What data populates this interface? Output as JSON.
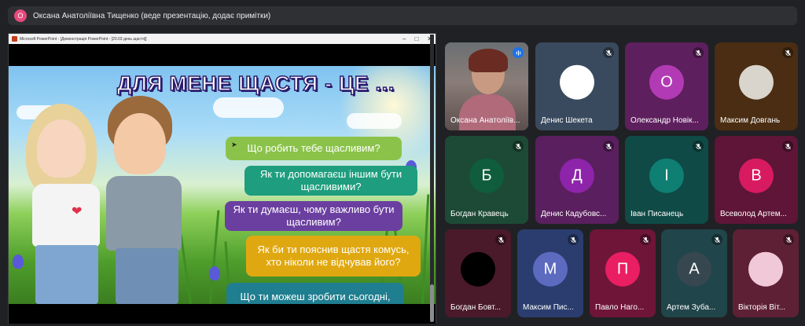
{
  "topbar": {
    "avatar_letter": "О",
    "presenter_text": "Оксана Анатоліївна Тищенко (веде презентацію, додає примітки)"
  },
  "presentation": {
    "window_title": "Microsoft PowerPoint - [Демонстрація PowerPoint - [20.03 день щастя]]",
    "window_controls": [
      "–",
      "□",
      "✕"
    ],
    "slide_title": "ДЛЯ МЕНЕ ЩАСТЯ - ЦЕ ...",
    "questions": [
      "Що робить тебе щасливим?",
      "Як ти допомагаєш іншим бути щасливими?",
      "Як ти думаєш, чому важливо бути щасливим?",
      "Як би ти пояснив щастя комусь, хто ніколи не відчував його?",
      "Що ти можеш зробити сьогодні, щоб зробити когось щасливішим"
    ]
  },
  "participants": [
    {
      "name": "Оксана Анатоліїв...",
      "type": "video",
      "speaking": true,
      "bg": "#3a3b3e",
      "accent": "#8ab4f8"
    },
    {
      "name": "Денис Шекета",
      "type": "blank",
      "bg": "#3a4a5e",
      "circle": "#ffffff"
    },
    {
      "name": "Олександр Новік...",
      "letter": "О",
      "bg": "#5e1f5e",
      "circle": "#b23bb5"
    },
    {
      "name": "Максим Довгань",
      "type": "photo",
      "bg": "#4a2d12",
      "circle": "#d9d4cc"
    },
    {
      "name": "Богдан Кравець",
      "letter": "Б",
      "bg": "#1d4a37",
      "circle": "#0f5d3c"
    },
    {
      "name": "Денис Кадубовс...",
      "letter": "Д",
      "bg": "#5a1f5e",
      "circle": "#8e24aa"
    },
    {
      "name": "Іван Писанець",
      "letter": "І",
      "bg": "#0f4a46",
      "circle": "#0e7f72"
    },
    {
      "name": "Всеволод Артем...",
      "letter": "В",
      "bg": "#5e1537",
      "circle": "#d81b60"
    },
    {
      "name": "Богдан Бовт...",
      "type": "photo-dark",
      "bg": "#4a1a2a",
      "circle": "#000000"
    },
    {
      "name": "Максим Пис...",
      "letter": "М",
      "bg": "#2a3d6e",
      "circle": "#5c6bc0"
    },
    {
      "name": "Павло Наго...",
      "letter": "П",
      "bg": "#6e1538",
      "circle": "#e91e63"
    },
    {
      "name": "Артем Зуба...",
      "letter": "А",
      "bg": "#20454a",
      "circle": "#37474f"
    },
    {
      "name": "Вікторія Віт...",
      "type": "photo",
      "bg": "#5e2035",
      "circle": "#f0c8d8"
    }
  ]
}
